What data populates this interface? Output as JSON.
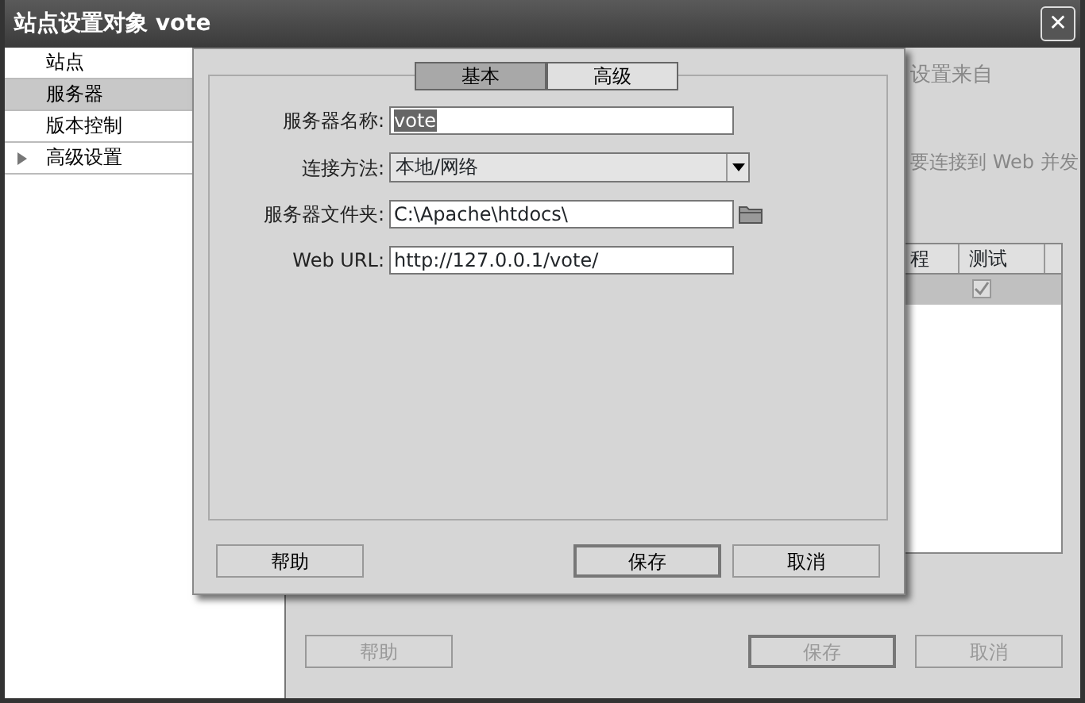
{
  "window": {
    "title": "站点设置对象 vote",
    "close": "✕"
  },
  "sidebar": {
    "items": [
      {
        "label": "站点",
        "selected": false,
        "kind": "leaf"
      },
      {
        "label": "服务器",
        "selected": true,
        "kind": "leaf"
      },
      {
        "label": "版本控制",
        "selected": false,
        "kind": "leaf"
      },
      {
        "label": "高级设置",
        "selected": false,
        "kind": "group",
        "expanded": false
      }
    ]
  },
  "background": {
    "texts": [
      "设置来自",
      "要连接到 Web 并发"
    ],
    "table": {
      "columns": [
        "程",
        "测试"
      ],
      "rows": [
        {
          "selected": true,
          "test_checked": true
        }
      ]
    },
    "buttons": [
      {
        "label": "帮助",
        "kind": "normal",
        "disabled": true
      },
      {
        "label": "保存",
        "kind": "default",
        "disabled": true
      },
      {
        "label": "取消",
        "kind": "normal",
        "disabled": true
      }
    ]
  },
  "dialog": {
    "tabs": [
      {
        "label": "基本",
        "selected": true
      },
      {
        "label": "高级",
        "selected": false
      }
    ],
    "fields": [
      {
        "label": "服务器名称:",
        "value": "vote",
        "kind": "text",
        "highlighted": true
      },
      {
        "label": "连接方法:",
        "value": "本地/网络",
        "kind": "select"
      },
      {
        "label": "服务器文件夹:",
        "value": "C:\\Apache\\htdocs\\",
        "kind": "folder"
      },
      {
        "label": "Web URL:",
        "value": "http://127.0.0.1/vote/",
        "kind": "text",
        "highlighted": false
      }
    ],
    "buttons": [
      {
        "label": "帮助",
        "kind": "normal"
      },
      {
        "label": "保存",
        "kind": "default"
      },
      {
        "label": "取消",
        "kind": "normal"
      }
    ]
  }
}
